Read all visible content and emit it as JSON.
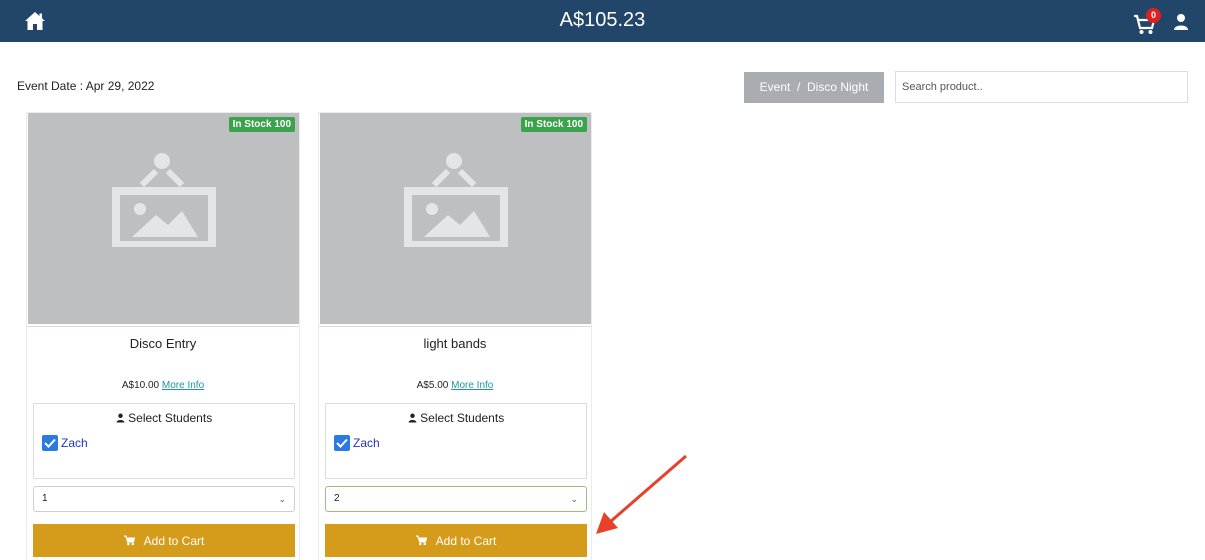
{
  "header": {
    "balance": "A$105.23",
    "cart_count": "0"
  },
  "event": {
    "date_label": "Event Date : Apr 29, 2022",
    "breadcrumb": "Event  /  Disco Night"
  },
  "search": {
    "placeholder": "Search product.."
  },
  "products": [
    {
      "stock_badge": "In Stock 100",
      "name": "Disco Entry",
      "price": "A$10.00",
      "more_info": "More Info",
      "students_title": "Select Students",
      "student": "Zach",
      "student_checked": true,
      "quantity": "1",
      "add_to_cart": "Add to Cart"
    },
    {
      "stock_badge": "In Stock 100",
      "name": "light bands",
      "price": "A$5.00",
      "more_info": "More Info",
      "students_title": "Select Students",
      "student": "Zach",
      "student_checked": true,
      "quantity": "2",
      "add_to_cart": "Add to Cart"
    }
  ],
  "colors": {
    "topbar": "#22466a",
    "add_to_cart": "#d59c1b",
    "stock_badge": "#3aa24a",
    "annotation_arrow": "#e8402a"
  },
  "icons": [
    "home-icon",
    "cart-icon",
    "user-icon",
    "image-placeholder-icon",
    "check-icon",
    "chevron-down-icon"
  ]
}
